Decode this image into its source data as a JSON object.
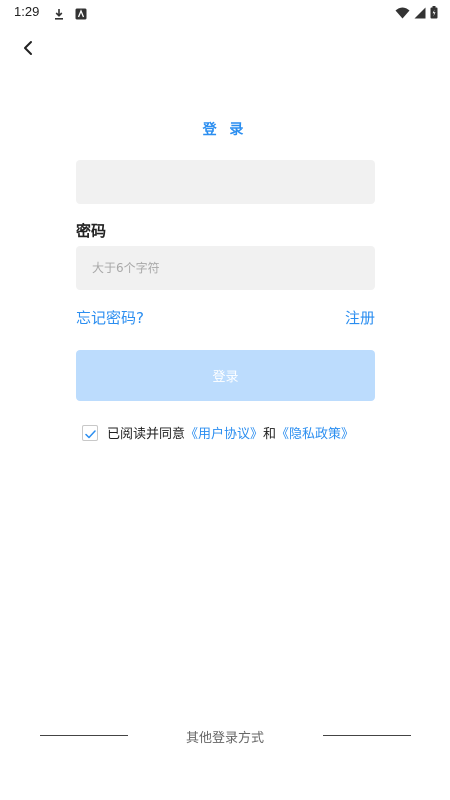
{
  "status_bar": {
    "time": "1:29"
  },
  "header": {
    "title": "登 录"
  },
  "form": {
    "account_placeholder": "",
    "password_label": "密码",
    "password_placeholder": "大于6个字符",
    "forgot_label": "忘记密码?",
    "register_label": "注册",
    "login_button": "登录"
  },
  "agreement": {
    "prefix": "已阅读并同意",
    "user_agreement": "《用户协议》",
    "conjunction": "和",
    "privacy_policy": "《隐私政策》",
    "checked": true
  },
  "footer": {
    "other_methods_label": "其他登录方式"
  },
  "colors": {
    "accent": "#2b8ef0",
    "login_button_disabled": "#bcdcfd",
    "input_bg": "#f1f1f1"
  }
}
